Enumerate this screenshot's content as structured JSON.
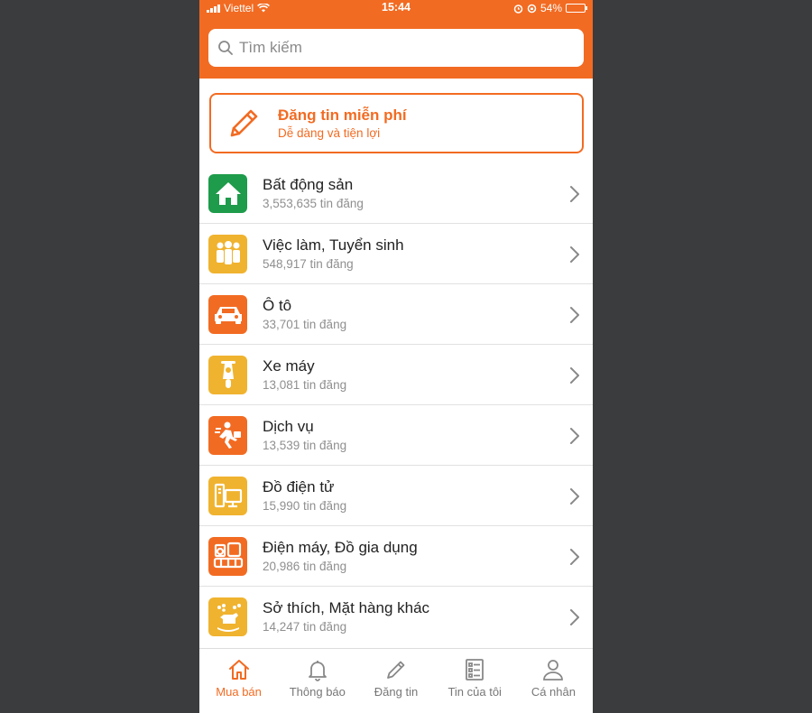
{
  "status_bar": {
    "carrier": "Viettel",
    "time": "15:44",
    "battery": "54%",
    "battery_level": 0.54
  },
  "search": {
    "placeholder": "Tìm kiếm"
  },
  "post_banner": {
    "title": "Đăng tin miễn phí",
    "subtitle": "Dễ dàng và tiện lợi"
  },
  "categories": [
    {
      "name": "Bất động sản",
      "count": "3,553,635 tin đăng",
      "icon": "house-icon",
      "color": "#1e9b4b"
    },
    {
      "name": "Việc làm, Tuyển sinh",
      "count": "548,917 tin đăng",
      "icon": "people-icon",
      "color": "#f0b32f"
    },
    {
      "name": "Ô tô",
      "count": "33,701 tin đăng",
      "icon": "car-icon",
      "color": "#f26b22"
    },
    {
      "name": "Xe máy",
      "count": "13,081 tin đăng",
      "icon": "scooter-icon",
      "color": "#f0b32f"
    },
    {
      "name": "Dịch vụ",
      "count": "13,539 tin đăng",
      "icon": "delivery-icon",
      "color": "#f26b22"
    },
    {
      "name": "Đồ điện tử",
      "count": "15,990 tin đăng",
      "icon": "computer-icon",
      "color": "#f0b32f"
    },
    {
      "name": "Điện máy, Đồ gia dụng",
      "count": "20,986 tin đăng",
      "icon": "appliance-icon",
      "color": "#f26b22"
    },
    {
      "name": "Sở thích, Mặt hàng khác",
      "count": "14,247 tin đăng",
      "icon": "rocking-horse-icon",
      "color": "#f0b32f"
    }
  ],
  "tabs": [
    {
      "label": "Mua bán",
      "icon": "home-icon",
      "active": true
    },
    {
      "label": "Thông báo",
      "icon": "bell-icon",
      "active": false
    },
    {
      "label": "Đăng tin",
      "icon": "pencil-icon",
      "active": false
    },
    {
      "label": "Tin của tôi",
      "icon": "list-icon",
      "active": false
    },
    {
      "label": "Cá nhân",
      "icon": "user-icon",
      "active": false
    }
  ],
  "colors": {
    "accent": "#f26b22",
    "background": "#3b3c3d"
  }
}
